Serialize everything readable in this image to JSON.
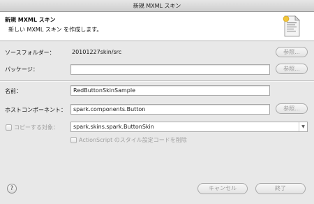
{
  "window": {
    "title": "新規 MXML スキン"
  },
  "header": {
    "title": "新規 MXML スキン",
    "description": "新しい MXML スキン を作成します。",
    "icon": "new-file-wizard-icon"
  },
  "form": {
    "source_folder": {
      "label": "ソースフォルダー：",
      "value": "20101227skin/src",
      "browse": "参照..."
    },
    "package": {
      "label": "パッケージ：",
      "value": "",
      "browse": "参照..."
    },
    "name": {
      "label": "名前：",
      "value": "RedButtonSkinSample"
    },
    "host_component": {
      "label": "ホストコンポーネント：",
      "value": "spark.components.Button",
      "browse": "参照..."
    },
    "copy_target": {
      "label": "コピーする対象：",
      "checked": false,
      "selected": "spark.skins.spark.ButtonSkin"
    },
    "remove_style": {
      "label": "ActionScript のスタイル設定コードを削除",
      "checked": false
    }
  },
  "footer": {
    "help": "?",
    "cancel": "キャンセル",
    "finish": "終了"
  }
}
